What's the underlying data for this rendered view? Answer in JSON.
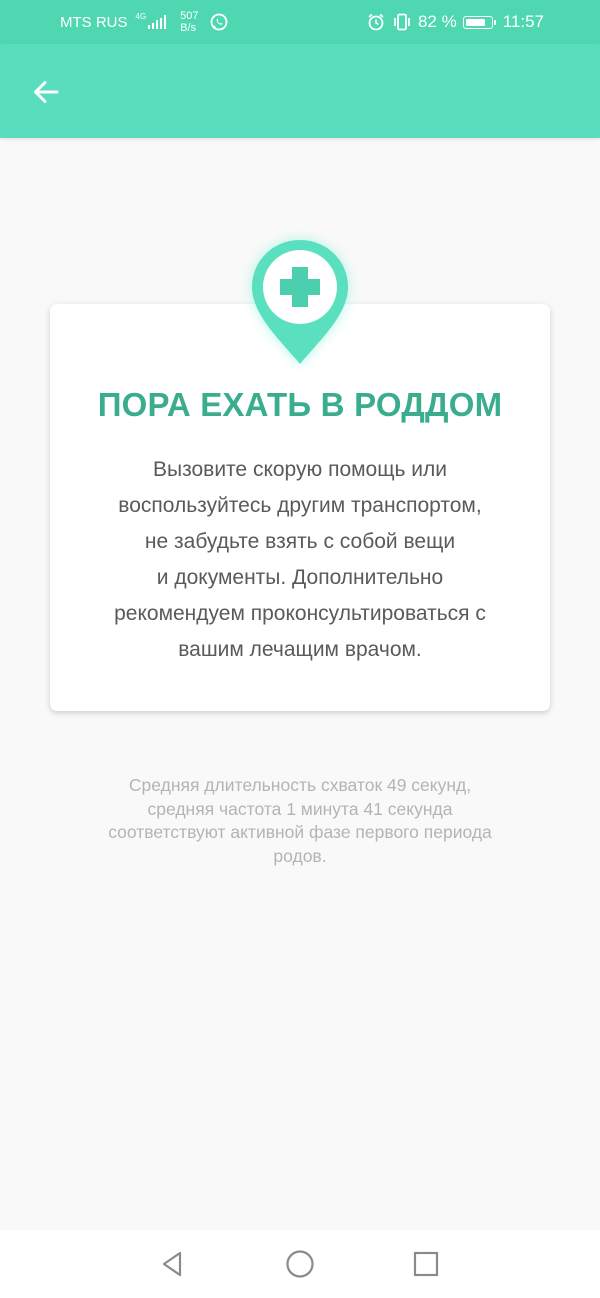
{
  "status_bar": {
    "carrier": "MTS RUS",
    "network_type": "4G",
    "speed_value": "507",
    "speed_unit": "B/s",
    "battery_percent": "82 %",
    "battery_level": 0.82,
    "time": "11:57",
    "icons": [
      "whatsapp-icon",
      "alarm-icon",
      "vibrate-icon",
      "battery-icon"
    ]
  },
  "app_bar": {
    "back_icon": "arrow-left-icon"
  },
  "card": {
    "icon": "medical-location-pin-icon",
    "title": "ПОРА ЕХАТЬ В РОДДОМ",
    "body": "Вызовите скорую помощь или\nвоспользуйтесь другим транспортом,\nне забудьте взять с собой вещи\nи документы. Дополнительно\nрекомендуем проконсультироваться с\nвашим лечащим врачом."
  },
  "footnote": "Средняя длительность схваток 49 секунд,\nсредняя частота 1 минута 41 секунда\nсоответствуют активной фазе первого периода\nродов.",
  "nav_bar": {
    "icons": [
      "back-triangle-icon",
      "home-circle-icon",
      "recents-square-icon"
    ]
  },
  "colors": {
    "status_bar": "#4fd7b1",
    "app_bar": "#5addbd",
    "accent": "#3aad8e",
    "pin": "#5adfbf",
    "background": "#f9f9f9"
  }
}
